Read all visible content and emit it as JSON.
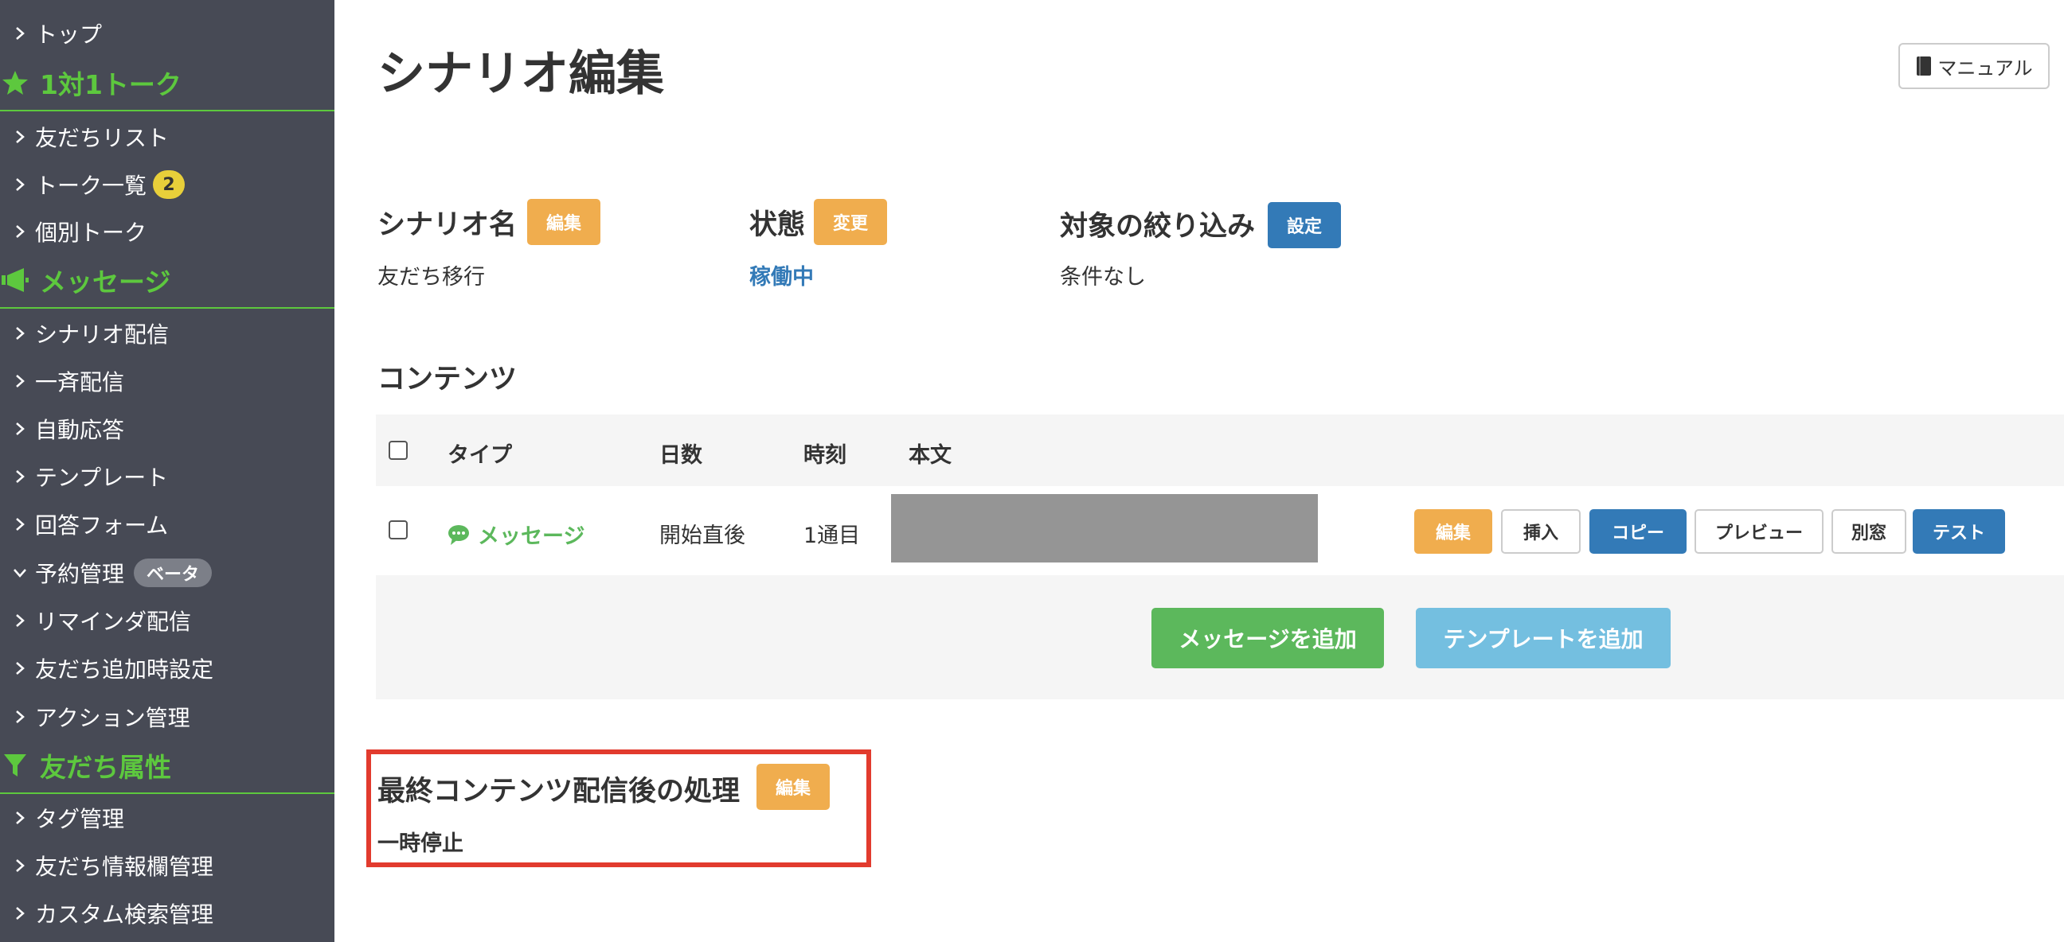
{
  "sidebar": {
    "top_item": "トップ",
    "sections": [
      {
        "title": "1対1トーク",
        "icon": "star-icon"
      },
      {
        "title": "メッセージ",
        "icon": "megaphone-icon"
      },
      {
        "title": "友だち属性",
        "icon": "filter-icon"
      }
    ],
    "talk_items": [
      "友だちリスト",
      "トーク一覧",
      "個別トーク"
    ],
    "talk_badge": "2",
    "message_items": [
      "シナリオ配信",
      "一斉配信",
      "自動応答",
      "テンプレート",
      "回答フォーム",
      "予約管理",
      "リマインダ配信",
      "友だち追加時設定",
      "アクション管理"
    ],
    "beta_badge": "ベータ",
    "attribute_items": [
      "タグ管理",
      "友だち情報欄管理",
      "カスタム検索管理"
    ]
  },
  "header": {
    "title": "シナリオ編集",
    "manual_label": "マニュアル"
  },
  "info": {
    "name_heading": "シナリオ名",
    "name_edit": "編集",
    "name_value": "友だち移行",
    "status_heading": "状態",
    "status_change": "変更",
    "status_value": "稼働中",
    "filter_heading": "対象の絞り込み",
    "filter_set": "設定",
    "filter_value": "条件なし"
  },
  "contents": {
    "heading": "コンテンツ",
    "columns": [
      "タイプ",
      "日数",
      "時刻",
      "本文"
    ],
    "row": {
      "type": "メッセージ",
      "days": "開始直後",
      "time": "1通目"
    },
    "row_actions": [
      "編集",
      "挿入",
      "コピー",
      "プレビュー",
      "別窓",
      "テスト"
    ],
    "add_message": "メッセージを追加",
    "add_template": "テンプレートを追加"
  },
  "final": {
    "heading": "最終コンテンツ配信後の処理",
    "edit": "編集",
    "value": "一時停止"
  },
  "colors": {
    "sidebar_bg": "#474a55",
    "sidebar_accent": "#5dc83e",
    "orange": "#f0ad4e",
    "blue": "#337ab7",
    "green": "#5cb85c",
    "highlight_border": "#e23b2e"
  }
}
